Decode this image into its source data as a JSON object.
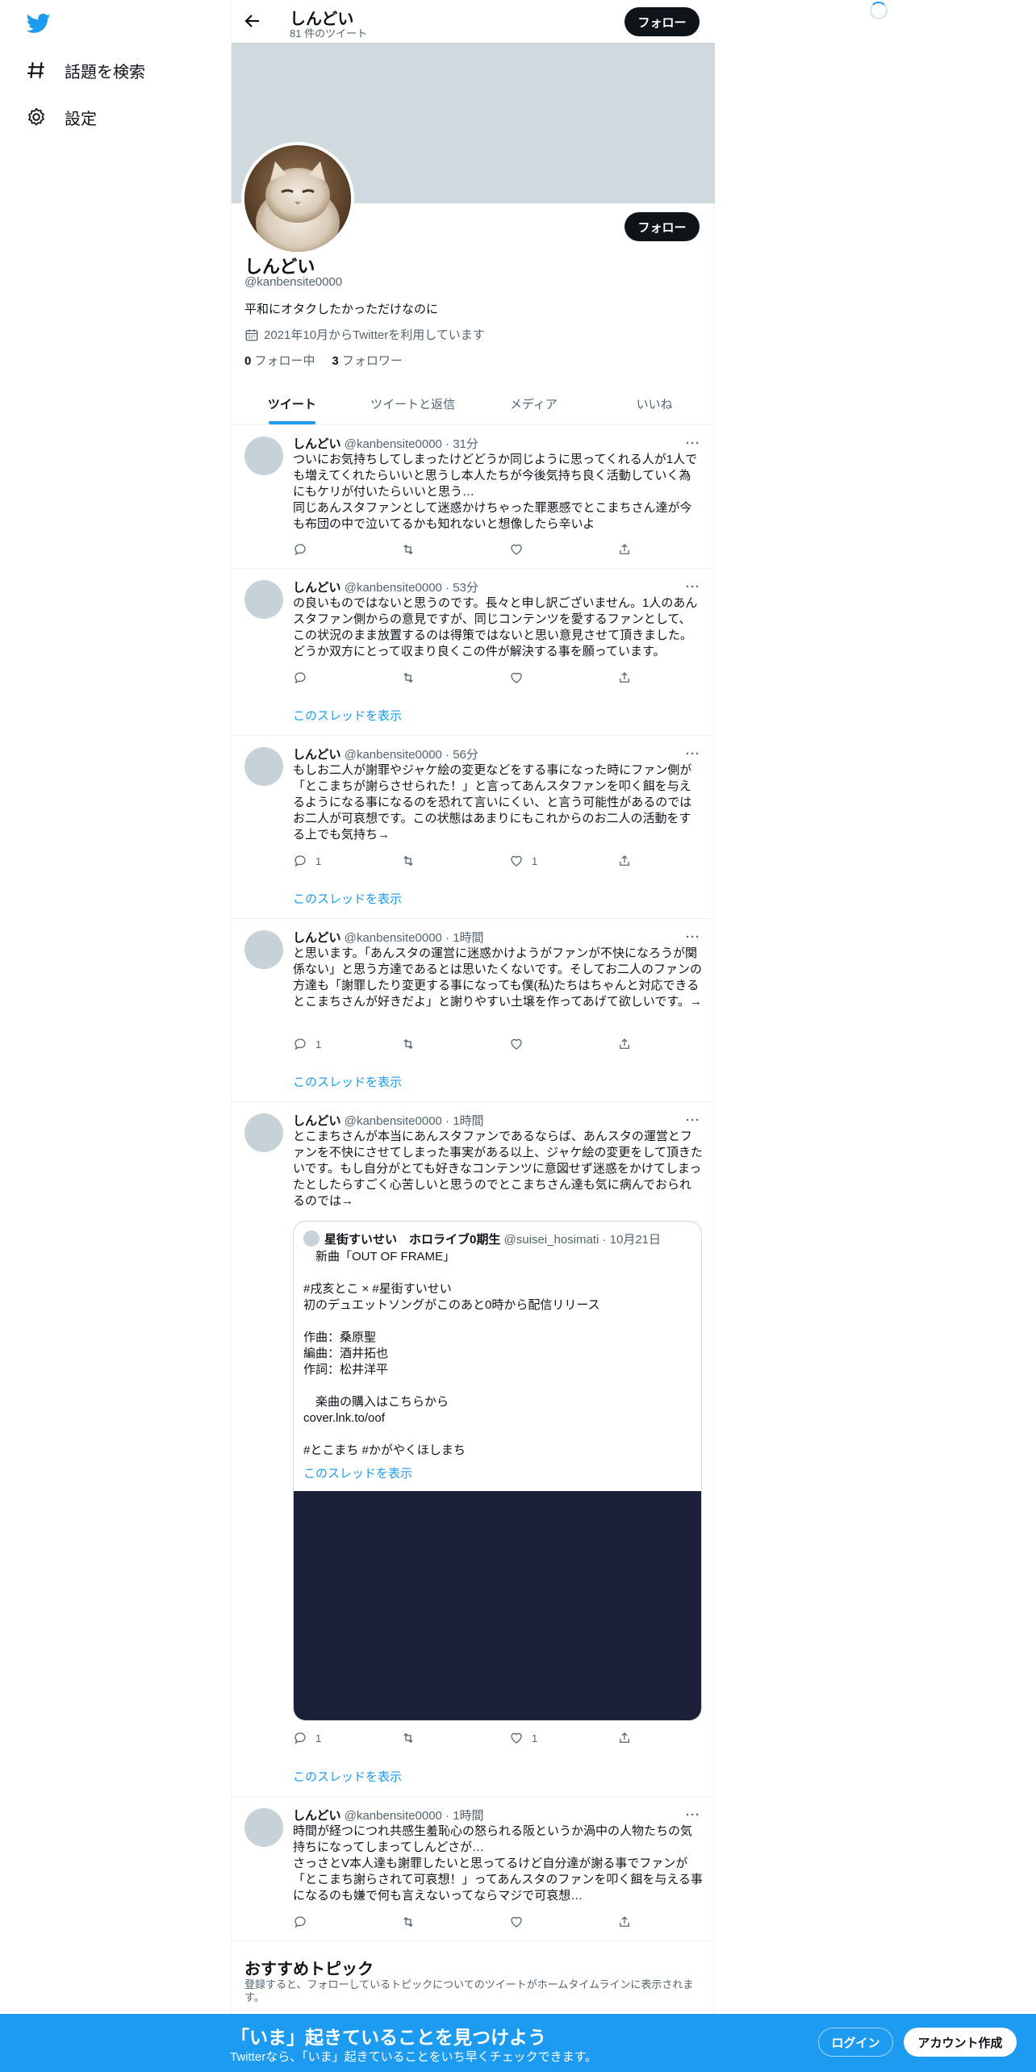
{
  "nav": {
    "items": [
      {
        "label": "話題を検索",
        "icon": "hashtag-icon"
      },
      {
        "label": "設定",
        "icon": "gear-icon"
      }
    ]
  },
  "header": {
    "name": "しんどい",
    "tweet_count": "81 件のツイート",
    "follow_label": "フォロー"
  },
  "profile": {
    "name": "しんどい",
    "handle": "@kanbensite0000",
    "bio": "平和にオタクしたかっただけなのに",
    "joined": "2021年10月からTwitterを利用しています",
    "following_count": "0",
    "following_label": "フォロー中",
    "followers_count": "3",
    "followers_label": "フォロワー",
    "follow_label": "フォロー"
  },
  "tabs": [
    "ツイート",
    "ツイートと返信",
    "メディア",
    "いいね"
  ],
  "thread_link": "このスレッドを表示",
  "tweets": [
    {
      "name": "しんどい",
      "meta": "@kanbensite0000 · 31分",
      "text": "ついにお気持ちしてしまったけどどうか同じように思ってくれる人が1人でも増えてくれたらいいと思うし本人たちが今後気持ち良く活動していく為にもケリが付いたらいいと思う…\n同じあんスタファンとして迷惑かけちゃった罪悪感でとこまちさん達が今も布団の中で泣いてるかも知れないと想像したら辛いよ",
      "reply": "",
      "retweet": "",
      "like": ""
    },
    {
      "name": "しんどい",
      "meta": "@kanbensite0000 · 53分",
      "text": "の良いものではないと思うのです。長々と申し訳ございません。1人のあんスタファン側からの意見ですが、同じコンテンツを愛するファンとして、この状況のまま放置するのは得策ではないと思い意見させて頂きました。どうか双方にとって収まり良くこの件が解決する事を願っています。",
      "reply": "",
      "retweet": "",
      "like": ""
    },
    {
      "name": "しんどい",
      "meta": "@kanbensite0000 · 56分",
      "text": "もしお二人が謝罪やジャケ絵の変更などをする事になった時にファン側が「とこまちが謝らさせられた！」と言ってあんスタファンを叩く餌を与えるようになる事になるのを恐れて言いにくい、と言う可能性があるのではお二人が可哀想です。この状態はあまりにもこれからのお二人の活動をする上でも気持ち→",
      "reply": "1",
      "retweet": "",
      "like": "1"
    },
    {
      "name": "しんどい",
      "meta": "@kanbensite0000 · 1時間",
      "text": "と思います。「あんスタの運営に迷惑かけようがファンが不快になろうが関係ない」と思う方達であるとは思いたくないです。そしてお二人のファンの方達も「謝罪したり変更する事になっても僕(私)たちはちゃんと対応できるとこまちさんが好きだよ」と謝りやすい土壌を作ってあげて欲しいです。→",
      "reply": "1",
      "retweet": "",
      "like": ""
    },
    {
      "name": "しんどい",
      "meta": "@kanbensite0000 · 1時間",
      "text": "とこまちさんが本当にあんスタファンであるならば、あんスタの運営とファンを不快にさせてしまった事実がある以上、ジャケ絵の変更をして頂きたいです。もし自分がとても好きなコンテンツに意図せず迷惑をかけてしまったとしたらすごく心苦しいと思うのでとこまちさん達も気に病んでおられるのでは→",
      "reply": "1",
      "retweet": "",
      "like": "1",
      "quote": {
        "name": "星街すいせい　ホロライブ0期生",
        "meta": "@suisei_hosimati · 10月21日",
        "text": "　新曲「OUT OF FRAME」\n\n#戌亥とこ × #星街すいせい\n初のデュエットソングがこのあと0時から配信リリース\n\n作曲：桑原聖\n編曲：酒井拓也\n作詞：松井洋平\n\n　楽曲の購入はこちらから\ncover.lnk.to/oof\n\n#とこまち #かがやくほしまち"
      }
    },
    {
      "name": "しんどい",
      "meta": "@kanbensite0000 · 1時間",
      "text": "時間が経つにつれ共感生羞恥心の怒られる阪というか渦中の人物たちの気持ちになってしまってしんどさが…\nさっさとV本人達も謝罪したいと思ってるけど自分達が謝る事でファンが「とこまち謝らされて可哀想！」ってあんスタのファンを叩く餌を与える事になるのも嫌で何も言えないってならマジで可哀想…",
      "reply": "",
      "retweet": "",
      "like": ""
    }
  ],
  "topics": {
    "title": "おすすめトピック",
    "subtitle": "登録すると、フォローしているトピックについてのツイートがホームタイムラインに表示されます。"
  },
  "bottom_bar": {
    "title": "「いま」起きていることを見つけよう",
    "subtitle": "Twitterなら、「いま」起きていることをいち早くチェックできます。",
    "login_label": "ログイン",
    "signup_label": "アカウント作成"
  },
  "colors": {
    "accent": "#1d9bf0",
    "text": "#0f1419",
    "muted": "#536471",
    "banner": "#cfd9de",
    "media": "#1b2038"
  }
}
